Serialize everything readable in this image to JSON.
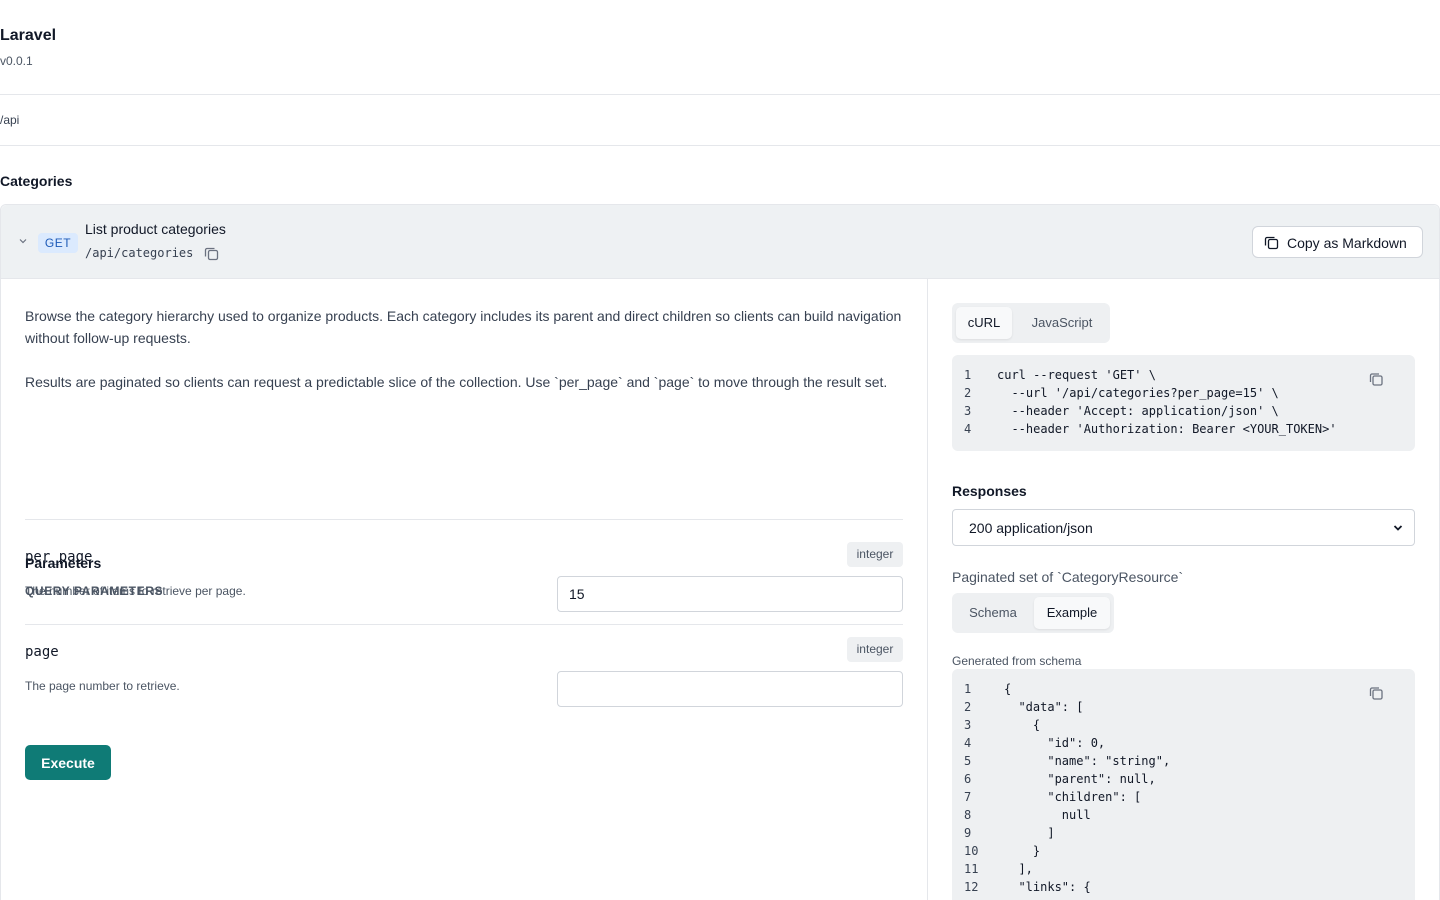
{
  "app": {
    "title": "Laravel",
    "version": "v0.0.1"
  },
  "base_path": "/api",
  "section": {
    "title": "Categories"
  },
  "endpoint": {
    "method": "GET",
    "summary": "List product categories",
    "path": "/api/categories",
    "copy_markdown_label": "Copy as Markdown",
    "description": [
      "Browse the category hierarchy used to organize products. Each category includes its parent and direct children so clients can build navigation without follow-up requests.",
      "Results are paginated so clients can request a predictable slice of the collection. Use `per_page` and `page` to move through the result set."
    ],
    "parameters_title": "Parameters",
    "query_parameters_title": "QUERY PARAMETERS",
    "params": [
      {
        "name": "per_page",
        "type": "integer",
        "description": "The number of items to retrieve per page.",
        "value": "15"
      },
      {
        "name": "page",
        "type": "integer",
        "description": "The page number to retrieve.",
        "value": ""
      }
    ],
    "execute_label": "Execute"
  },
  "request_example": {
    "tabs": [
      "cURL",
      "JavaScript"
    ],
    "active_tab": "cURL",
    "lines": [
      "curl --request 'GET' \\",
      "  --url '/api/categories?per_page=15' \\",
      "  --header 'Accept: application/json' \\",
      "  --header 'Authorization: Bearer <YOUR_TOKEN>'"
    ]
  },
  "responses": {
    "title": "Responses",
    "selected": "200 application/json",
    "description": "Paginated set of `CategoryResource`",
    "tabs": [
      "Schema",
      "Example"
    ],
    "active_tab": "Example",
    "generated_note": "Generated from schema",
    "lines": [
      "{",
      "  \"data\": [",
      "    {",
      "      \"id\": 0,",
      "      \"name\": \"string\",",
      "      \"parent\": null,",
      "      \"children\": [",
      "        null",
      "      ]",
      "    }",
      "  ],",
      "  \"links\": {"
    ]
  },
  "icons": {
    "chevron": "chevron-down-icon",
    "copy": "copy-icon"
  },
  "colors": {
    "accent": "#0f7b76",
    "get_badge_bg": "#dbeafe",
    "get_badge_text": "#1e5bb8",
    "header_bg": "#eef1f3",
    "code_bg": "#eef0f2"
  }
}
